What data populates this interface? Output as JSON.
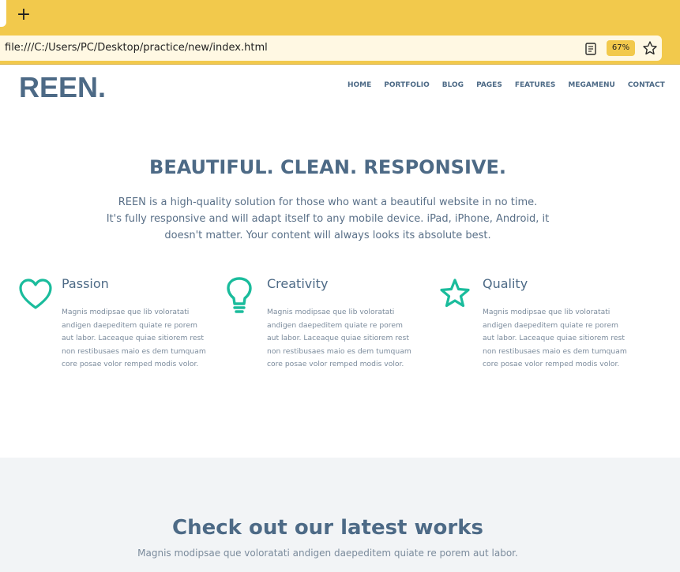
{
  "browser": {
    "new_tab_glyph": "+",
    "url": "file:///C:/Users/PC/Desktop/practice/new/index.html",
    "zoom": "67%",
    "icons": [
      "reader-view-icon",
      "star-icon"
    ]
  },
  "header": {
    "logo": "REEN.",
    "nav": [
      "HOME",
      "PORTFOLIO",
      "BLOG",
      "PAGES",
      "FEATURES",
      "MEGAMENU",
      "CONTACT"
    ]
  },
  "hero": {
    "title": "BEAUTIFUL. CLEAN. RESPONSIVE.",
    "description_lines": [
      "REEN is a high-quality solution for those who want a beautiful website in no time.",
      "It's fully responsive and will adapt itself to any mobile device. iPad, iPhone, Android, it",
      "doesn't matter. Your content will always looks its absolute best."
    ]
  },
  "features": [
    {
      "icon": "heart-icon",
      "title": "Passion",
      "text_lines": [
        "Magnis modipsae que lib voloratati",
        "andigen daepeditem quiate re porem",
        "aut labor. Laceaque quiae sitiorem rest",
        "non restibusaes maio es dem tumquam",
        "core posae volor remped modis volor."
      ]
    },
    {
      "icon": "lightbulb-icon",
      "title": "Creativity",
      "text_lines": [
        "Magnis modipsae que lib voloratati",
        "andigen daepeditem quiate re porem",
        "aut labor. Laceaque quiae sitiorem rest",
        "non restibusaes maio es dem tumquam",
        "core posae volor remped modis volor."
      ]
    },
    {
      "icon": "star-icon",
      "title": "Quality",
      "text_lines": [
        "Magnis modipsae que lib voloratati",
        "andigen daepeditem quiate re porem",
        "aut labor. Laceaque quiae sitiorem rest",
        "non restibusaes maio es dem tumquam",
        "core posae volor remped modis volor."
      ]
    }
  ],
  "works": {
    "title": "Check out our latest works",
    "subtitle": "Magnis modipsae que voloratati andigen daepeditem quiate re porem aut labor."
  },
  "colors": {
    "brand": "#4d6a86",
    "accent": "#1abc9c",
    "chrome": "#f2c94c"
  }
}
